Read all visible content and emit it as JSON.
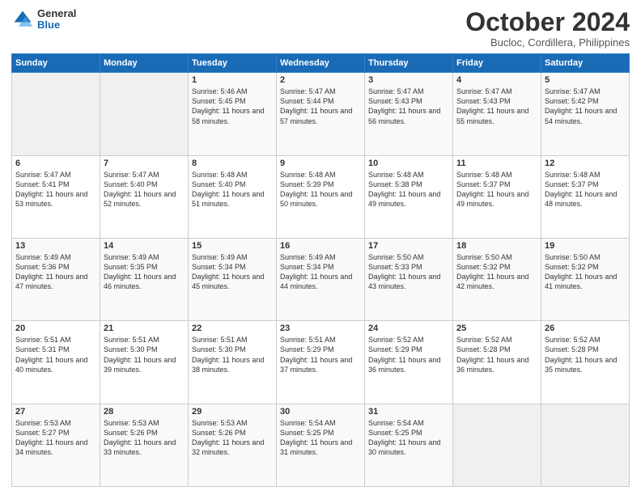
{
  "header": {
    "logo_general": "General",
    "logo_blue": "Blue",
    "title": "October 2024",
    "subtitle": "Bucloc, Cordillera, Philippines"
  },
  "columns": [
    "Sunday",
    "Monday",
    "Tuesday",
    "Wednesday",
    "Thursday",
    "Friday",
    "Saturday"
  ],
  "weeks": [
    [
      {
        "day": "",
        "info": ""
      },
      {
        "day": "",
        "info": ""
      },
      {
        "day": "1",
        "info": "Sunrise: 5:46 AM\nSunset: 5:45 PM\nDaylight: 11 hours and 58 minutes."
      },
      {
        "day": "2",
        "info": "Sunrise: 5:47 AM\nSunset: 5:44 PM\nDaylight: 11 hours and 57 minutes."
      },
      {
        "day": "3",
        "info": "Sunrise: 5:47 AM\nSunset: 5:43 PM\nDaylight: 11 hours and 56 minutes."
      },
      {
        "day": "4",
        "info": "Sunrise: 5:47 AM\nSunset: 5:43 PM\nDaylight: 11 hours and 55 minutes."
      },
      {
        "day": "5",
        "info": "Sunrise: 5:47 AM\nSunset: 5:42 PM\nDaylight: 11 hours and 54 minutes."
      }
    ],
    [
      {
        "day": "6",
        "info": "Sunrise: 5:47 AM\nSunset: 5:41 PM\nDaylight: 11 hours and 53 minutes."
      },
      {
        "day": "7",
        "info": "Sunrise: 5:47 AM\nSunset: 5:40 PM\nDaylight: 11 hours and 52 minutes."
      },
      {
        "day": "8",
        "info": "Sunrise: 5:48 AM\nSunset: 5:40 PM\nDaylight: 11 hours and 51 minutes."
      },
      {
        "day": "9",
        "info": "Sunrise: 5:48 AM\nSunset: 5:39 PM\nDaylight: 11 hours and 50 minutes."
      },
      {
        "day": "10",
        "info": "Sunrise: 5:48 AM\nSunset: 5:38 PM\nDaylight: 11 hours and 49 minutes."
      },
      {
        "day": "11",
        "info": "Sunrise: 5:48 AM\nSunset: 5:37 PM\nDaylight: 11 hours and 49 minutes."
      },
      {
        "day": "12",
        "info": "Sunrise: 5:48 AM\nSunset: 5:37 PM\nDaylight: 11 hours and 48 minutes."
      }
    ],
    [
      {
        "day": "13",
        "info": "Sunrise: 5:49 AM\nSunset: 5:36 PM\nDaylight: 11 hours and 47 minutes."
      },
      {
        "day": "14",
        "info": "Sunrise: 5:49 AM\nSunset: 5:35 PM\nDaylight: 11 hours and 46 minutes."
      },
      {
        "day": "15",
        "info": "Sunrise: 5:49 AM\nSunset: 5:34 PM\nDaylight: 11 hours and 45 minutes."
      },
      {
        "day": "16",
        "info": "Sunrise: 5:49 AM\nSunset: 5:34 PM\nDaylight: 11 hours and 44 minutes."
      },
      {
        "day": "17",
        "info": "Sunrise: 5:50 AM\nSunset: 5:33 PM\nDaylight: 11 hours and 43 minutes."
      },
      {
        "day": "18",
        "info": "Sunrise: 5:50 AM\nSunset: 5:32 PM\nDaylight: 11 hours and 42 minutes."
      },
      {
        "day": "19",
        "info": "Sunrise: 5:50 AM\nSunset: 5:32 PM\nDaylight: 11 hours and 41 minutes."
      }
    ],
    [
      {
        "day": "20",
        "info": "Sunrise: 5:51 AM\nSunset: 5:31 PM\nDaylight: 11 hours and 40 minutes."
      },
      {
        "day": "21",
        "info": "Sunrise: 5:51 AM\nSunset: 5:30 PM\nDaylight: 11 hours and 39 minutes."
      },
      {
        "day": "22",
        "info": "Sunrise: 5:51 AM\nSunset: 5:30 PM\nDaylight: 11 hours and 38 minutes."
      },
      {
        "day": "23",
        "info": "Sunrise: 5:51 AM\nSunset: 5:29 PM\nDaylight: 11 hours and 37 minutes."
      },
      {
        "day": "24",
        "info": "Sunrise: 5:52 AM\nSunset: 5:29 PM\nDaylight: 11 hours and 36 minutes."
      },
      {
        "day": "25",
        "info": "Sunrise: 5:52 AM\nSunset: 5:28 PM\nDaylight: 11 hours and 36 minutes."
      },
      {
        "day": "26",
        "info": "Sunrise: 5:52 AM\nSunset: 5:28 PM\nDaylight: 11 hours and 35 minutes."
      }
    ],
    [
      {
        "day": "27",
        "info": "Sunrise: 5:53 AM\nSunset: 5:27 PM\nDaylight: 11 hours and 34 minutes."
      },
      {
        "day": "28",
        "info": "Sunrise: 5:53 AM\nSunset: 5:26 PM\nDaylight: 11 hours and 33 minutes."
      },
      {
        "day": "29",
        "info": "Sunrise: 5:53 AM\nSunset: 5:26 PM\nDaylight: 11 hours and 32 minutes."
      },
      {
        "day": "30",
        "info": "Sunrise: 5:54 AM\nSunset: 5:25 PM\nDaylight: 11 hours and 31 minutes."
      },
      {
        "day": "31",
        "info": "Sunrise: 5:54 AM\nSunset: 5:25 PM\nDaylight: 11 hours and 30 minutes."
      },
      {
        "day": "",
        "info": ""
      },
      {
        "day": "",
        "info": ""
      }
    ]
  ]
}
